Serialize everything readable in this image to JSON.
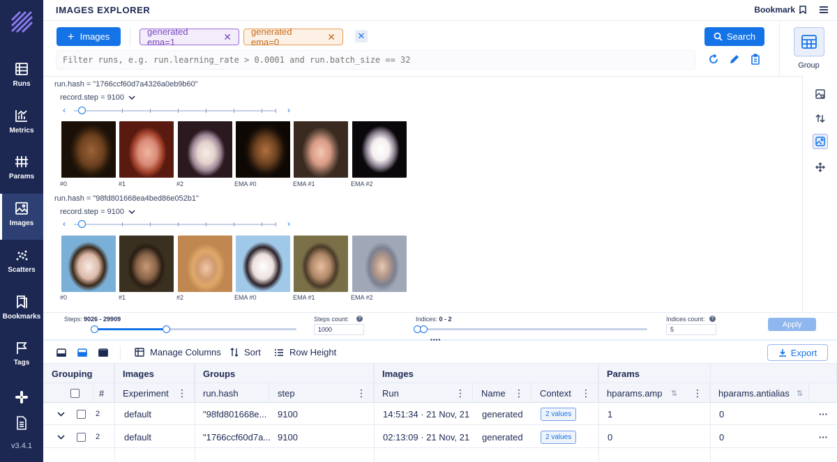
{
  "app": {
    "title": "IMAGES EXPLORER",
    "bookmark_label": "Bookmark",
    "version": "v3.4.1"
  },
  "sidebar": {
    "items": [
      {
        "label": "Runs",
        "icon": "runs-icon"
      },
      {
        "label": "Metrics",
        "icon": "metrics-icon"
      },
      {
        "label": "Params",
        "icon": "params-icon"
      },
      {
        "label": "Images",
        "icon": "images-icon"
      },
      {
        "label": "Scatters",
        "icon": "scatters-icon"
      },
      {
        "label": "Bookmarks",
        "icon": "bookmarks-icon"
      },
      {
        "label": "Tags",
        "icon": "tags-icon"
      }
    ],
    "active": "Images"
  },
  "search": {
    "images_button": "Images",
    "chips": [
      "generated ema=1",
      "generated ema=0"
    ],
    "search_button": "Search",
    "filter_placeholder": "Filter runs, e.g. run.learning_rate > 0.0001 and run.batch_size == 32",
    "group_label": "Group"
  },
  "runs": [
    {
      "hash": "run.hash = \"1766ccf60d7a4326a0eb9b60\"",
      "record_step": "record.step = 9100",
      "captions": [
        "#0",
        "#1",
        "#2",
        "EMA #0",
        "EMA #1",
        "EMA #2"
      ]
    },
    {
      "hash": "run.hash = \"98fd801668ea4bed86e052b1\"",
      "record_step": "record.step = 9100",
      "captions": [
        "#0",
        "#1",
        "#2",
        "EMA #0",
        "EMA #1",
        "EMA #2"
      ]
    }
  ],
  "range": {
    "steps_label": "Steps:",
    "steps_value": "9026 - 29909",
    "steps_count_label": "Steps count:",
    "steps_count_value": "1000",
    "indices_label": "Indices:",
    "indices_value": "0 - 2",
    "indices_count_label": "Indices count:",
    "indices_count_value": "5",
    "apply_label": "Apply"
  },
  "table_toolbar": {
    "manage_columns": "Manage Columns",
    "sort": "Sort",
    "row_height": "Row Height",
    "export": "Export"
  },
  "table": {
    "groups_header": [
      "Grouping",
      "Images",
      "Groups",
      "Images",
      "Params"
    ],
    "columns": {
      "hash_sign": "#",
      "experiment": "Experiment",
      "run_hash": "run.hash",
      "step": "step",
      "run": "Run",
      "name": "Name",
      "context": "Context",
      "amp": "hparams.amp",
      "antialias": "hparams.antialias"
    },
    "rows": [
      {
        "count": "2",
        "experiment": "default",
        "run_hash": "\"98fd801668e...",
        "step": "9100",
        "run": "14:51:34 · 21 Nov, 21",
        "name": "generated",
        "context": "2 values",
        "amp": "1",
        "antialias": "0"
      },
      {
        "count": "2",
        "experiment": "default",
        "run_hash": "\"1766ccf60d7a...",
        "step": "9100",
        "run": "02:13:09 · 21 Nov, 21",
        "name": "generated",
        "context": "2 values",
        "amp": "0",
        "antialias": "0"
      }
    ]
  },
  "colors": {
    "sidebar": "#1c2852",
    "primary": "#1473e6",
    "chip_purple": "#9a6ad6",
    "chip_orange": "#e89a52"
  }
}
